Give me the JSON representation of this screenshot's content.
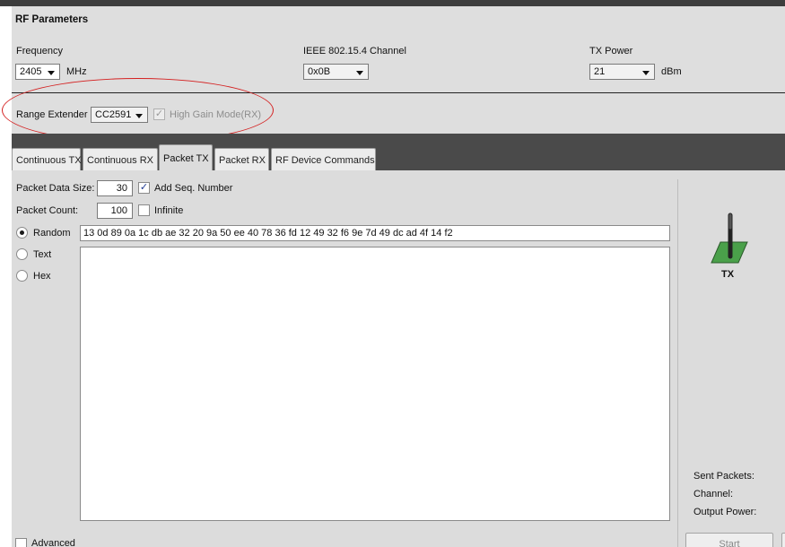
{
  "rf_parameters": {
    "title": "RF Parameters",
    "frequency": {
      "label": "Frequency",
      "value": "2405",
      "unit": "MHz"
    },
    "channel": {
      "label": "IEEE 802.15.4 Channel",
      "value": "0x0B"
    },
    "tx_power": {
      "label": "TX Power",
      "value": "21",
      "unit": "dBm"
    },
    "range_extender": {
      "label": "Range Extender",
      "value": "CC2591",
      "high_gain_label": "High Gain Mode(RX)",
      "high_gain_checked": true,
      "high_gain_enabled": false
    },
    "annotation_color": "#d42020"
  },
  "tabs": [
    {
      "label": "Continuous TX",
      "active": false
    },
    {
      "label": "Continuous RX",
      "active": false
    },
    {
      "label": "Packet TX",
      "active": true
    },
    {
      "label": "Packet RX",
      "active": false
    },
    {
      "label": "RF Device Commands",
      "active": false
    }
  ],
  "packet_tx": {
    "data_size": {
      "label": "Packet Data Size:",
      "value": "30"
    },
    "add_seq": {
      "label": "Add Seq. Number",
      "checked": true
    },
    "count": {
      "label": "Packet Count:",
      "value": "100"
    },
    "infinite": {
      "label": "Infinite",
      "checked": false
    },
    "payload_modes": [
      {
        "label": "Random",
        "selected": true
      },
      {
        "label": "Text",
        "selected": false
      },
      {
        "label": "Hex",
        "selected": false
      }
    ],
    "random_data": "13 0d 89 0a 1c db ae 32 20 9a 50 ee 40 78 36 fd 12 49 32 f6 9e 7d 49 dc ad 4f 14 f2",
    "text_data": "",
    "advanced": {
      "label": "Advanced",
      "checked": false
    }
  },
  "status": {
    "icon_label": "TX",
    "sent_packets_label": "Sent Packets:",
    "channel_label": "Channel:",
    "output_power_label": "Output Power:",
    "start_label": "Start"
  },
  "colors": {
    "antenna_green": "#4aa04a",
    "dark_band": "#4a4a4a",
    "top_bar": "#3d3d3d"
  }
}
